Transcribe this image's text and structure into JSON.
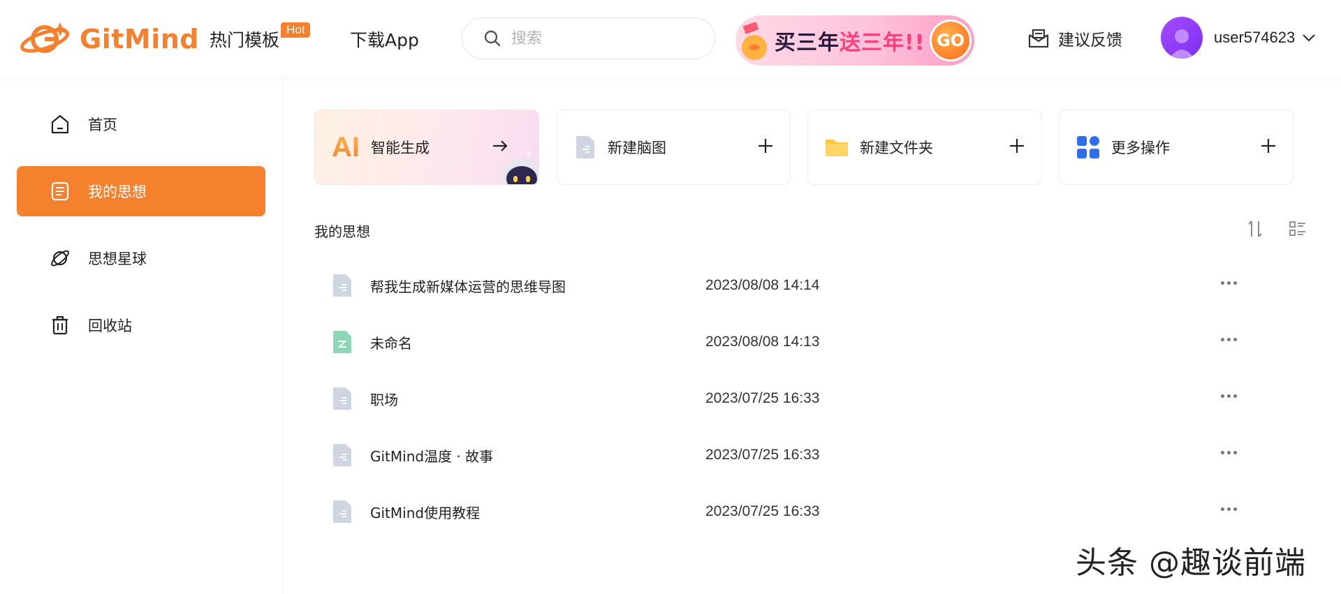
{
  "header": {
    "logo_text": "GitMind",
    "nav": [
      {
        "label": "热门模板",
        "badge": "Hot"
      },
      {
        "label": "下载App"
      }
    ],
    "search": {
      "placeholder": "搜索",
      "value": ""
    },
    "promo": {
      "text_part1": "买三年",
      "text_part2": "送三年!!",
      "button": "GO"
    },
    "feedback_label": "建议反馈",
    "username": "user574623"
  },
  "sidebar": {
    "items": [
      {
        "label": "首页",
        "icon": "home-icon",
        "active": false
      },
      {
        "label": "我的思想",
        "icon": "document-icon",
        "active": true
      },
      {
        "label": "思想星球",
        "icon": "planet-icon",
        "active": false
      },
      {
        "label": "回收站",
        "icon": "trash-icon",
        "active": false
      }
    ]
  },
  "actions": [
    {
      "label": "智能生成",
      "icon_text": "AI",
      "action": "arrow-right-icon"
    },
    {
      "label": "新建脑图",
      "icon": "mindmap-file-icon",
      "action": "plus-icon"
    },
    {
      "label": "新建文件夹",
      "icon": "folder-icon",
      "action": "plus-icon"
    },
    {
      "label": "更多操作",
      "icon": "grid-apps-icon",
      "action": "plus-icon"
    }
  ],
  "section_title": "我的思想",
  "files": [
    {
      "name": "帮我生成新媒体运营的思维导图",
      "date": "2023/08/08 14:14",
      "icon": "mindmap-file-icon"
    },
    {
      "name": "未命名",
      "date": "2023/08/08 14:13",
      "icon": "flowchart-file-icon"
    },
    {
      "name": "职场",
      "date": "2023/07/25 16:33",
      "icon": "mindmap-file-icon"
    },
    {
      "name": "GitMind温度 · 故事",
      "date": "2023/07/25 16:33",
      "icon": "mindmap-file-icon"
    },
    {
      "name": "GitMind使用教程",
      "date": "2023/07/25 16:33",
      "icon": "mindmap-file-icon"
    }
  ],
  "watermark": "头条 @趣谈前端",
  "colors": {
    "accent": "#f5812e",
    "file_gray": "#cfd6e1",
    "file_green": "#8ed6b6",
    "folder": "#ffc53d",
    "grid_blue": "#2f6fed"
  }
}
